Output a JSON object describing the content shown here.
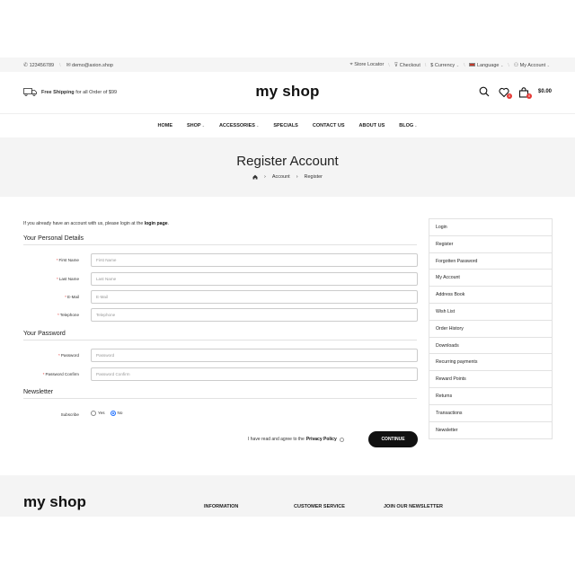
{
  "topbar": {
    "phone": "123456789",
    "email": "demo@axion.shop",
    "store_locator": "Store Locator",
    "checkout": "Checkout",
    "currency": "$ Currency",
    "language": "Language",
    "my_account": "My Account"
  },
  "header": {
    "shipping_bold": "Free Shipping",
    "shipping_rest": "for all Order of $99",
    "logo": "my shop",
    "wishlist_count": "0",
    "cart_count": "0",
    "cart_total": "$0.00"
  },
  "nav": {
    "items": [
      "HOME",
      "SHOP",
      "ACCESSORIES",
      "SPECIALS",
      "CONTACT US",
      "ABOUT US",
      "BLOG"
    ]
  },
  "banner": {
    "title": "Register Account",
    "crumb_account": "Account",
    "crumb_register": "Register"
  },
  "form": {
    "intro_text": "If you already have an account with us, please login at the",
    "intro_link": "login page",
    "intro_end": ".",
    "personal_title": "Your Personal Details",
    "firstname_label": "First Name",
    "firstname_placeholder": "First Name",
    "lastname_label": "Last Name",
    "lastname_placeholder": "Last Name",
    "email_label": "E-Mail",
    "email_placeholder": "E-Mail",
    "telephone_label": "Telephone",
    "telephone_placeholder": "Telephone",
    "password_title": "Your Password",
    "password_label": "Password",
    "password_placeholder": "Password",
    "confirm_label": "Password Confirm",
    "confirm_placeholder": "Password Confirm",
    "newsletter_title": "Newsletter",
    "subscribe_label": "Subscribe",
    "yes_label": "Yes",
    "no_label": "No",
    "agree_text": "I have read and agree to the",
    "privacy_policy": "Privacy Policy",
    "continue_label": "CONTINUE"
  },
  "sidebar": {
    "items": [
      "Login",
      "Register",
      "Forgotten Password",
      "My Account",
      "Address Book",
      "Wish List",
      "Order History",
      "Downloads",
      "Recurring payments",
      "Reward Points",
      "Returns",
      "Transactions",
      "Newsletter"
    ]
  },
  "footer": {
    "logo": "my shop",
    "information": "INFORMATION",
    "customer_service": "CUSTOMER SERVICE",
    "newsletter": "JOIN OUR NEWSLETTER"
  },
  "colors": {
    "accent_red": "#e53935",
    "dark": "#111111",
    "light_bg": "#f4f4f4"
  }
}
